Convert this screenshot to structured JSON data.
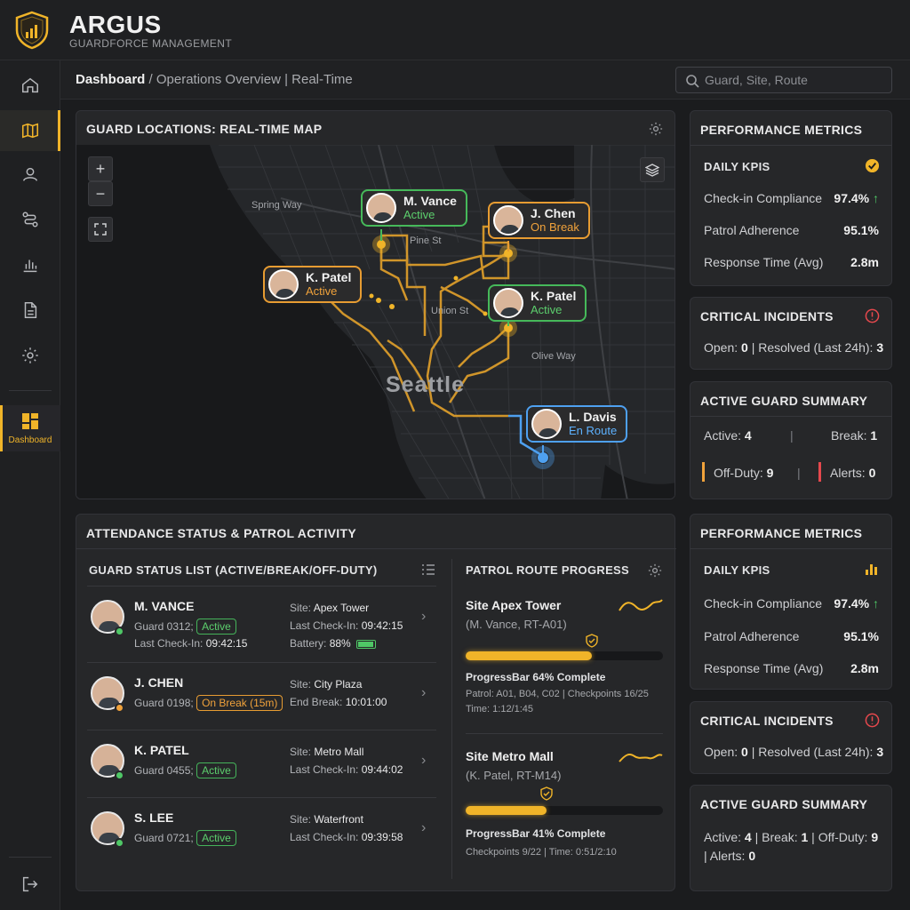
{
  "brand": {
    "title": "ARGUS",
    "subtitle": "GUARDFORCE MANAGEMENT"
  },
  "nav": {
    "dashboard_label": "Dashboard"
  },
  "breadcrumb": {
    "current": "Dashboard",
    "rest": " / Operations Overview | Real-Time"
  },
  "search": {
    "placeholder": "Guard, Site, Route"
  },
  "map": {
    "title": "GUARD LOCATIONS: REAL-TIME MAP",
    "city": "Seattle",
    "streets": {
      "spring": "Spring Way",
      "pine": "Pine St",
      "union": "Union St",
      "olive": "Olive Way"
    },
    "pins": [
      {
        "name": "M. Vance",
        "status": "Active"
      },
      {
        "name": "J. Chen",
        "status": "On Break"
      },
      {
        "name": "K. Patel",
        "status": "Active"
      },
      {
        "name": "K. Patel",
        "status": "Active"
      },
      {
        "name": "L. Davis",
        "status": "En Route"
      }
    ]
  },
  "attendance": {
    "title": "ATTENDANCE STATUS & PATROL ACTIVITY",
    "list_title": "GUARD STATUS LIST (ACTIVE/BREAK/OFF-DUTY)",
    "guards": [
      {
        "name": "M. VANCE",
        "guard": "Guard 0312;",
        "badge": "Active",
        "checkin_label": "Last Check-In:",
        "checkin": "09:42:15",
        "site_label": "Site:",
        "site": "Apex Tower",
        "r2_label": "Last Check-In:",
        "r2": "09:42:15",
        "battery_label": "Battery:",
        "battery": "88%"
      },
      {
        "name": "J. CHEN",
        "guard": "Guard 0198;",
        "badge": "On Break (15m)",
        "site_label": "Site:",
        "site": "City Plaza",
        "r2_label": "End Break:",
        "r2": "10:01:00"
      },
      {
        "name": "K. PATEL",
        "guard": "Guard 0455;",
        "badge": "Active",
        "site_label": "Site:",
        "site": "Metro Mall",
        "r2_label": "Last Check-In:",
        "r2": "09:44:02"
      },
      {
        "name": "S. LEE",
        "guard": "Guard 0721;",
        "badge": "Active",
        "site_label": "Site:",
        "site": "Waterfront",
        "r2_label": "Last Check-In:",
        "r2": "09:39:58"
      }
    ],
    "routes_title": "PATROL ROUTE PROGRESS",
    "routes": [
      {
        "site": "Site Apex Tower",
        "sub": "(M. Vance, RT-A01)",
        "progress": 64,
        "progress_label": "ProgressBar 64% Complete",
        "detail1": "Patrol: A01, B04, C02 | Checkpoints 16/25",
        "detail2": "Time: 1:12/1:45"
      },
      {
        "site": "Site Metro Mall",
        "sub": "(K. Patel, RT-M14)",
        "progress": 41,
        "progress_label": "ProgressBar 41% Complete",
        "detail1": "Checkpoints 9/22 | Time: 0:51/2:10"
      }
    ]
  },
  "metrics": {
    "title": "PERFORMANCE METRICS",
    "kpi_title": "DAILY KPIS",
    "rows": [
      {
        "label": "Check-in Compliance",
        "value": "97.4%",
        "arrow": "↑"
      },
      {
        "label": "Patrol Adherence",
        "value": "95.1%"
      },
      {
        "label": "Response Time (Avg)",
        "value": "2.8m"
      }
    ]
  },
  "incidents": {
    "title": "CRITICAL INCIDENTS",
    "open_label": "Open:",
    "open": "0",
    "resolved_label": " | Resolved (Last 24h):",
    "resolved": "3"
  },
  "summary": {
    "title": "ACTIVE GUARD SUMMARY",
    "active_label": "Active:",
    "active": "4",
    "break_label": "Break:",
    "break": "1",
    "offduty_label": "Off-Duty:",
    "offduty": "9",
    "alerts_label": "Alerts:",
    "alerts": "0",
    "compact_a": "Active: ",
    "compact_b": " | Break: ",
    "compact_c": " | Off-Duty: ",
    "compact_d": "| Alerts: "
  },
  "colors": {
    "accent": "#f0b429",
    "active": "#5ccf6d",
    "break": "#f0a23b",
    "route": "#5eb2ff",
    "alert": "#e5484d"
  }
}
